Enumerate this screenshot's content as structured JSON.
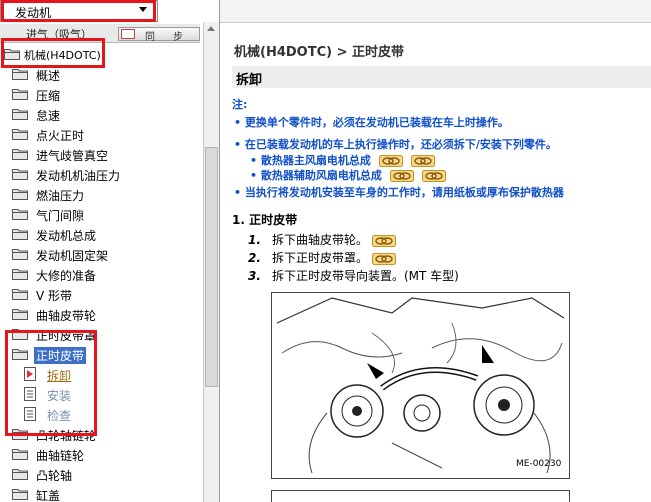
{
  "sidebar": {
    "dropdown_value": "发动机",
    "strip_label": "进气（吸气）",
    "sync_label": "同步",
    "root_label": "机械(H4DOTC)",
    "nodes": [
      {
        "label": "概述"
      },
      {
        "label": "压缩"
      },
      {
        "label": "怠速"
      },
      {
        "label": "点火正时"
      },
      {
        "label": "进气歧管真空"
      },
      {
        "label": "发动机机油压力"
      },
      {
        "label": "燃油压力"
      },
      {
        "label": "气门间隙"
      },
      {
        "label": "发动机总成"
      },
      {
        "label": "发动机固定架"
      },
      {
        "label": "大修的准备"
      },
      {
        "label": "V 形带"
      },
      {
        "label": "曲轴皮带轮"
      },
      {
        "label": "正时皮带罩"
      },
      {
        "label": "正时皮带"
      }
    ],
    "leaves": [
      {
        "label": "拆卸"
      },
      {
        "label": "安装"
      },
      {
        "label": "检查"
      }
    ],
    "nodes_after": [
      {
        "label": "凸轮轴链轮"
      },
      {
        "label": "曲轴链轮"
      },
      {
        "label": "凸轮轴"
      },
      {
        "label": "缸盖"
      }
    ]
  },
  "content": {
    "breadcrumb": "机械(H4DOTC) > 正时皮带",
    "section_title": "拆卸",
    "note_label": "注:",
    "notes": [
      "更换单个零件时，必须在发动机已装载在车上时操作。",
      "在已装载发动机的车上执行操作时，还必须拆下/安装下列零件。",
      "散热器主风扇电机总成",
      "散热器辅助风扇电机总成",
      "当执行将发动机安装至车身的工作时，请用纸板或厚布保护散热器"
    ],
    "step_title": "1.  正时皮带",
    "substeps": [
      {
        "num": "1.",
        "text": "拆下曲轴皮带轮。"
      },
      {
        "num": "2.",
        "text": "拆下正时皮带罩。"
      },
      {
        "num": "3.",
        "text": "拆下正时皮带导向装置。(MT 车型)"
      }
    ],
    "figure_label": "ME-00230"
  },
  "colors": {
    "highlight_red": "#e8141c",
    "selection_blue": "#3d6fc6",
    "note_blue": "#1050c8"
  }
}
